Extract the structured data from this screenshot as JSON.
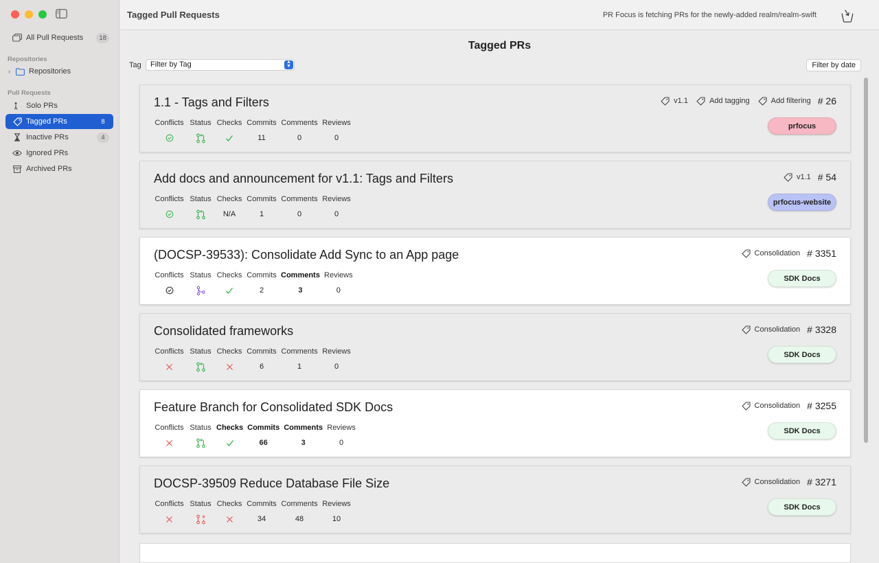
{
  "window": {
    "title": "Tagged Pull Requests",
    "status_text": "PR Focus is fetching PRs for the newly-added realm/realm-swift"
  },
  "sidebar": {
    "all": {
      "label": "All Pull Requests",
      "count": "18"
    },
    "repositories_section": "Repositories",
    "repositories_item": "Repositories",
    "pull_requests_section": "Pull Requests",
    "items": [
      {
        "label": "Solo PRs",
        "count": "",
        "icon": "person-icon"
      },
      {
        "label": "Tagged PRs",
        "count": "8",
        "icon": "tag-icon",
        "active": true
      },
      {
        "label": "Inactive PRs",
        "count": "4",
        "icon": "hourglass-icon"
      },
      {
        "label": "Ignored PRs",
        "count": "",
        "icon": "eye-icon"
      },
      {
        "label": "Archived PRs",
        "count": "",
        "icon": "archive-icon"
      }
    ]
  },
  "main": {
    "page_title": "Tagged PRs",
    "tag_label": "Tag",
    "tag_filter_value": "Filter by Tag",
    "filter_date_label": "Filter by date"
  },
  "columns": {
    "conflicts": "Conflicts",
    "status": "Status",
    "checks": "Checks",
    "commits": "Commits",
    "comments": "Comments",
    "reviews": "Reviews"
  },
  "prs": [
    {
      "title": "1.1 - Tags and Filters",
      "number": "# 26",
      "tags": [
        "v1.1",
        "Add tagging",
        "Add filtering"
      ],
      "repo": "prfocus",
      "repo_color": "#f7b8c3",
      "background": "grey",
      "conflicts": "ok",
      "status": "open",
      "checks": "pass",
      "commits": "11",
      "comments": "0",
      "reviews": "0"
    },
    {
      "title": "Add docs and announcement for v1.1: Tags and Filters",
      "number": "# 54",
      "tags": [
        "v1.1"
      ],
      "repo": "prfocus-website",
      "repo_color": "#b9c2f5",
      "background": "grey",
      "conflicts": "ok",
      "status": "open",
      "checks": "N/A",
      "commits": "1",
      "comments": "0",
      "reviews": "0"
    },
    {
      "title": "(DOCSP-39533): Consolidate Add Sync to an App page",
      "number": "# 3351",
      "tags": [
        "Consolidation"
      ],
      "repo": "SDK Docs",
      "repo_color": "#e8f8ec",
      "background": "white",
      "conflicts": "neutral",
      "status": "merged",
      "checks": "pass",
      "commits": "2",
      "comments": "3",
      "reviews": "0",
      "bold": [
        "comments"
      ]
    },
    {
      "title": "Consolidated frameworks",
      "number": "# 3328",
      "tags": [
        "Consolidation"
      ],
      "repo": "SDK Docs",
      "repo_color": "#e8f8ec",
      "background": "grey",
      "conflicts": "fail",
      "status": "open",
      "checks": "fail",
      "commits": "6",
      "comments": "1",
      "reviews": "0"
    },
    {
      "title": "Feature Branch for Consolidated SDK Docs",
      "number": "# 3255",
      "tags": [
        "Consolidation"
      ],
      "repo": "SDK Docs",
      "repo_color": "#e8f8ec",
      "background": "white",
      "conflicts": "fail",
      "status": "open",
      "checks": "pass",
      "commits": "66",
      "comments": "3",
      "reviews": "0",
      "bold": [
        "checks",
        "commits",
        "comments"
      ]
    },
    {
      "title": "DOCSP-39509 Reduce Database File Size",
      "number": "# 3271",
      "tags": [
        "Consolidation"
      ],
      "repo": "SDK Docs",
      "repo_color": "#e8f8ec",
      "background": "grey",
      "conflicts": "fail",
      "status": "closed",
      "checks": "fail",
      "commits": "34",
      "comments": "48",
      "reviews": "10"
    }
  ]
}
